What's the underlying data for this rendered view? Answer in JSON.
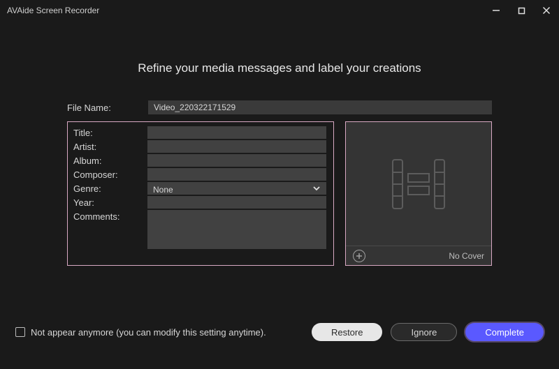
{
  "app_title": "AVAide Screen Recorder",
  "heading": "Refine your media messages and label your creations",
  "filename_label": "File Name:",
  "filename_value": "Video_220322171529",
  "fields": {
    "title_label": "Title:",
    "title_value": "",
    "artist_label": "Artist:",
    "artist_value": "",
    "album_label": "Album:",
    "album_value": "",
    "composer_label": "Composer:",
    "composer_value": "",
    "genre_label": "Genre:",
    "genre_value": "None",
    "year_label": "Year:",
    "year_value": "",
    "comments_label": "Comments:",
    "comments_value": ""
  },
  "cover": {
    "no_cover_label": "No Cover"
  },
  "footer": {
    "checkbox_label": "Not appear anymore (you can modify this setting anytime).",
    "restore": "Restore",
    "ignore": "Ignore",
    "complete": "Complete"
  }
}
